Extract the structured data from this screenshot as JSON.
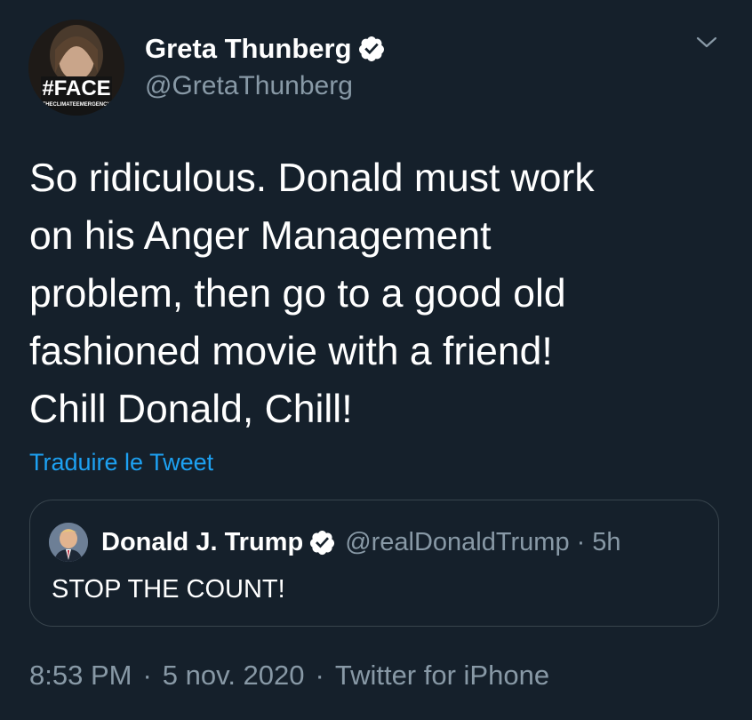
{
  "author": {
    "display_name": "Greta Thunberg",
    "handle": "@GretaThunberg",
    "avatar_text_main": "#FACE",
    "avatar_text_sub": "THECLIMATEEMERGENCY",
    "verified_icon": "verified-badge-icon"
  },
  "menu": {
    "icon": "chevron-down-icon"
  },
  "tweet": {
    "lines": [
      "So ridiculous. Donald must work",
      "on his Anger Management",
      "problem, then go to a good old",
      "fashioned movie with a friend!",
      "Chill Donald, Chill!"
    ],
    "translate_label": "Traduire le Tweet"
  },
  "quoted": {
    "display_name": "Donald J. Trump",
    "handle": "@realDonaldTrump",
    "separator": "·",
    "time": "5h",
    "text": "STOP THE COUNT!"
  },
  "footer": {
    "time": "8:53 PM",
    "date": "5 nov. 2020",
    "source": "Twitter for iPhone",
    "separator": "·"
  },
  "colors": {
    "background": "#15202b",
    "primary_text": "#ffffff",
    "secondary_text": "#8899a6",
    "link": "#1da1f2",
    "border": "#38444d"
  }
}
